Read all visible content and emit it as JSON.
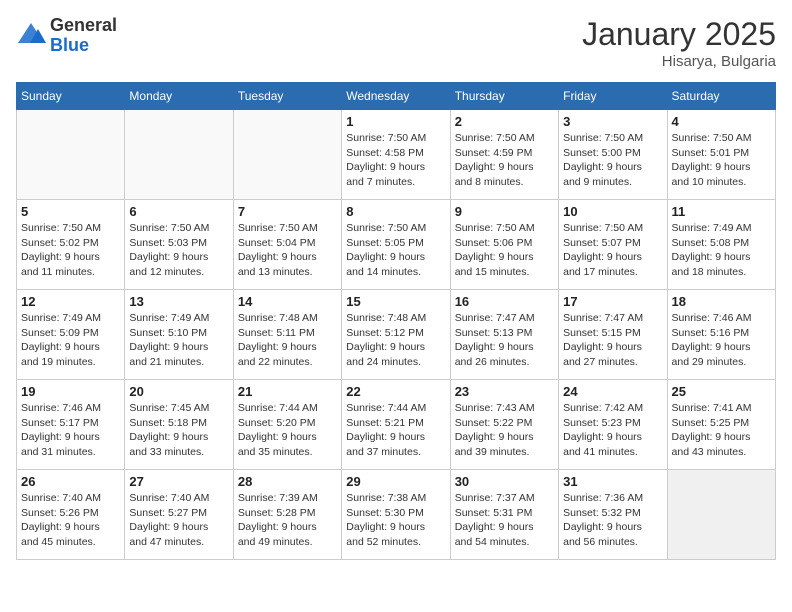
{
  "logo": {
    "general": "General",
    "blue": "Blue"
  },
  "header": {
    "month_year": "January 2025",
    "location": "Hisarya, Bulgaria"
  },
  "weekdays": [
    "Sunday",
    "Monday",
    "Tuesday",
    "Wednesday",
    "Thursday",
    "Friday",
    "Saturday"
  ],
  "weeks": [
    [
      {
        "day": "",
        "info": ""
      },
      {
        "day": "",
        "info": ""
      },
      {
        "day": "",
        "info": ""
      },
      {
        "day": "1",
        "info": "Sunrise: 7:50 AM\nSunset: 4:58 PM\nDaylight: 9 hours\nand 7 minutes."
      },
      {
        "day": "2",
        "info": "Sunrise: 7:50 AM\nSunset: 4:59 PM\nDaylight: 9 hours\nand 8 minutes."
      },
      {
        "day": "3",
        "info": "Sunrise: 7:50 AM\nSunset: 5:00 PM\nDaylight: 9 hours\nand 9 minutes."
      },
      {
        "day": "4",
        "info": "Sunrise: 7:50 AM\nSunset: 5:01 PM\nDaylight: 9 hours\nand 10 minutes."
      }
    ],
    [
      {
        "day": "5",
        "info": "Sunrise: 7:50 AM\nSunset: 5:02 PM\nDaylight: 9 hours\nand 11 minutes."
      },
      {
        "day": "6",
        "info": "Sunrise: 7:50 AM\nSunset: 5:03 PM\nDaylight: 9 hours\nand 12 minutes."
      },
      {
        "day": "7",
        "info": "Sunrise: 7:50 AM\nSunset: 5:04 PM\nDaylight: 9 hours\nand 13 minutes."
      },
      {
        "day": "8",
        "info": "Sunrise: 7:50 AM\nSunset: 5:05 PM\nDaylight: 9 hours\nand 14 minutes."
      },
      {
        "day": "9",
        "info": "Sunrise: 7:50 AM\nSunset: 5:06 PM\nDaylight: 9 hours\nand 15 minutes."
      },
      {
        "day": "10",
        "info": "Sunrise: 7:50 AM\nSunset: 5:07 PM\nDaylight: 9 hours\nand 17 minutes."
      },
      {
        "day": "11",
        "info": "Sunrise: 7:49 AM\nSunset: 5:08 PM\nDaylight: 9 hours\nand 18 minutes."
      }
    ],
    [
      {
        "day": "12",
        "info": "Sunrise: 7:49 AM\nSunset: 5:09 PM\nDaylight: 9 hours\nand 19 minutes."
      },
      {
        "day": "13",
        "info": "Sunrise: 7:49 AM\nSunset: 5:10 PM\nDaylight: 9 hours\nand 21 minutes."
      },
      {
        "day": "14",
        "info": "Sunrise: 7:48 AM\nSunset: 5:11 PM\nDaylight: 9 hours\nand 22 minutes."
      },
      {
        "day": "15",
        "info": "Sunrise: 7:48 AM\nSunset: 5:12 PM\nDaylight: 9 hours\nand 24 minutes."
      },
      {
        "day": "16",
        "info": "Sunrise: 7:47 AM\nSunset: 5:13 PM\nDaylight: 9 hours\nand 26 minutes."
      },
      {
        "day": "17",
        "info": "Sunrise: 7:47 AM\nSunset: 5:15 PM\nDaylight: 9 hours\nand 27 minutes."
      },
      {
        "day": "18",
        "info": "Sunrise: 7:46 AM\nSunset: 5:16 PM\nDaylight: 9 hours\nand 29 minutes."
      }
    ],
    [
      {
        "day": "19",
        "info": "Sunrise: 7:46 AM\nSunset: 5:17 PM\nDaylight: 9 hours\nand 31 minutes."
      },
      {
        "day": "20",
        "info": "Sunrise: 7:45 AM\nSunset: 5:18 PM\nDaylight: 9 hours\nand 33 minutes."
      },
      {
        "day": "21",
        "info": "Sunrise: 7:44 AM\nSunset: 5:20 PM\nDaylight: 9 hours\nand 35 minutes."
      },
      {
        "day": "22",
        "info": "Sunrise: 7:44 AM\nSunset: 5:21 PM\nDaylight: 9 hours\nand 37 minutes."
      },
      {
        "day": "23",
        "info": "Sunrise: 7:43 AM\nSunset: 5:22 PM\nDaylight: 9 hours\nand 39 minutes."
      },
      {
        "day": "24",
        "info": "Sunrise: 7:42 AM\nSunset: 5:23 PM\nDaylight: 9 hours\nand 41 minutes."
      },
      {
        "day": "25",
        "info": "Sunrise: 7:41 AM\nSunset: 5:25 PM\nDaylight: 9 hours\nand 43 minutes."
      }
    ],
    [
      {
        "day": "26",
        "info": "Sunrise: 7:40 AM\nSunset: 5:26 PM\nDaylight: 9 hours\nand 45 minutes."
      },
      {
        "day": "27",
        "info": "Sunrise: 7:40 AM\nSunset: 5:27 PM\nDaylight: 9 hours\nand 47 minutes."
      },
      {
        "day": "28",
        "info": "Sunrise: 7:39 AM\nSunset: 5:28 PM\nDaylight: 9 hours\nand 49 minutes."
      },
      {
        "day": "29",
        "info": "Sunrise: 7:38 AM\nSunset: 5:30 PM\nDaylight: 9 hours\nand 52 minutes."
      },
      {
        "day": "30",
        "info": "Sunrise: 7:37 AM\nSunset: 5:31 PM\nDaylight: 9 hours\nand 54 minutes."
      },
      {
        "day": "31",
        "info": "Sunrise: 7:36 AM\nSunset: 5:32 PM\nDaylight: 9 hours\nand 56 minutes."
      },
      {
        "day": "",
        "info": ""
      }
    ]
  ]
}
